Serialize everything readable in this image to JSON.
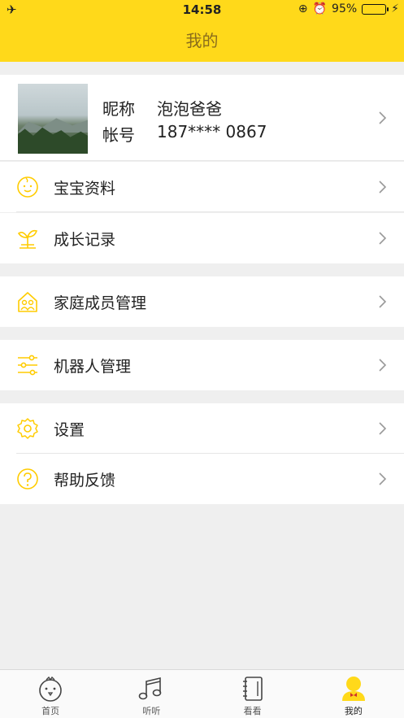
{
  "status_bar": {
    "time": "14:58",
    "battery": "95%"
  },
  "nav": {
    "title": "我的"
  },
  "profile": {
    "nickname_label": "昵称",
    "nickname": "泡泡爸爸",
    "account_label": "帐号",
    "account": "187**** 0867"
  },
  "menu": {
    "baby_profile": "宝宝资料",
    "growth_record": "成长记录",
    "family_members": "家庭成员管理",
    "robot_management": "机器人管理",
    "settings": "设置",
    "help_feedback": "帮助反馈"
  },
  "tabs": {
    "home": "首页",
    "listen": "听听",
    "watch": "看看",
    "mine": "我的"
  },
  "colors": {
    "accent": "#ffd91a",
    "icon": "#ffcc00",
    "title": "#8a6d1c"
  }
}
